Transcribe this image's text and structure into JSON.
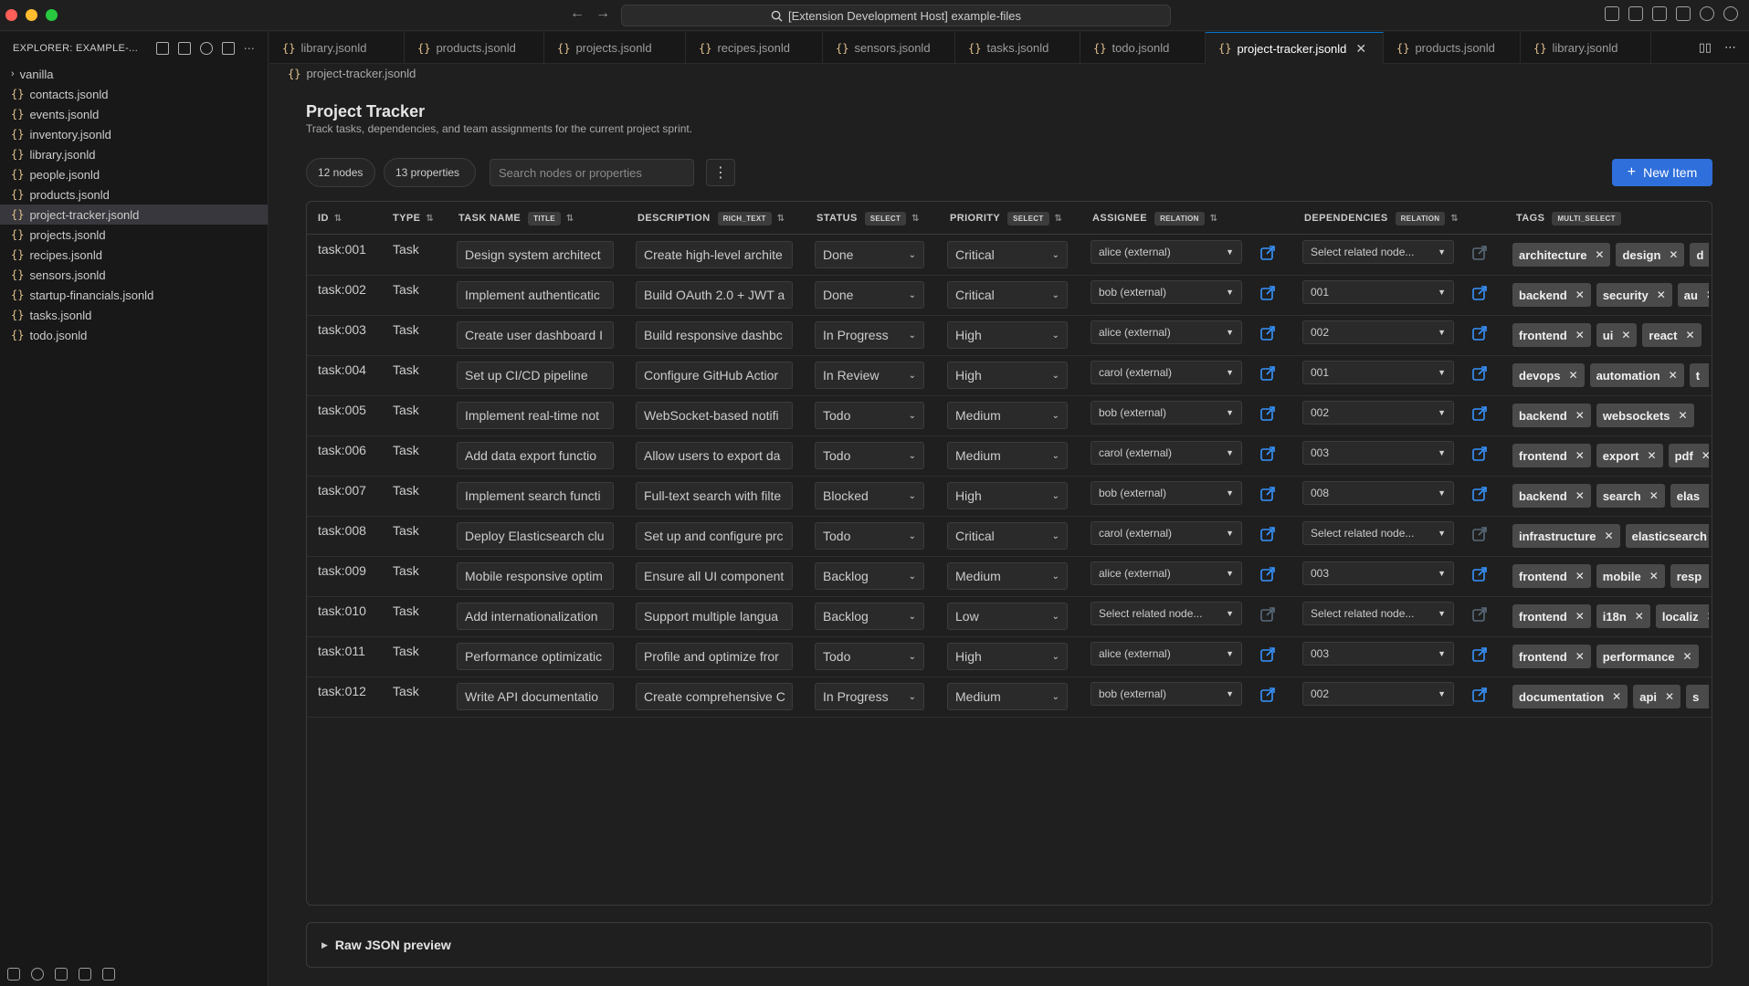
{
  "window": {
    "search": "[Extension Development Host] example-files",
    "nav_back": "←",
    "nav_forward": "→"
  },
  "sidebar": {
    "header": "EXPLORER: EXAMPLE-...",
    "folder": "vanilla",
    "files": [
      "contacts.jsonld",
      "events.jsonld",
      "inventory.jsonld",
      "library.jsonld",
      "people.jsonld",
      "products.jsonld",
      "project-tracker.jsonld",
      "projects.jsonld",
      "recipes.jsonld",
      "sensors.jsonld",
      "startup-financials.jsonld",
      "tasks.jsonld",
      "todo.jsonld"
    ],
    "selected": "project-tracker.jsonld"
  },
  "tabs": [
    "library.jsonld",
    "products.jsonld",
    "projects.jsonld",
    "recipes.jsonld",
    "sensors.jsonld",
    "tasks.jsonld",
    "todo.jsonld",
    "project-tracker.jsonld",
    "products.jsonld",
    "library.jsonld"
  ],
  "active_tab": "project-tracker.jsonld",
  "breadcrumb": "project-tracker.jsonld",
  "page": {
    "title": "Project Tracker",
    "subtitle": "Track tasks, dependencies, and team assignments for the current project sprint."
  },
  "toolbar": {
    "nodes": "12 nodes",
    "properties": "13 properties",
    "search_placeholder": "Search nodes or properties",
    "kebab": "⋮",
    "new_item": "New Item"
  },
  "columns": {
    "id": "ID",
    "type": "TYPE",
    "task_name": "TASK NAME",
    "task_name_badge": "TITLE",
    "description": "DESCRIPTION",
    "description_badge": "RICH_TEXT",
    "status": "STATUS",
    "status_badge": "SELECT",
    "priority": "PRIORITY",
    "priority_badge": "SELECT",
    "assignee": "ASSIGNEE",
    "assignee_badge": "RELATION",
    "dependencies": "DEPENDENCIES",
    "dependencies_badge": "RELATION",
    "tags": "TAGS",
    "tags_badge": "MULTI_SELECT"
  },
  "rows": [
    {
      "id": "task:001",
      "type": "Task",
      "name": "Design system architect",
      "desc": "Create high-level archite",
      "status": "Done",
      "priority": "Critical",
      "assignee": "alice (external)",
      "assignee_set": true,
      "deps": "Select related node...",
      "deps_set": false,
      "tags": [
        "architecture",
        "design",
        "d"
      ]
    },
    {
      "id": "task:002",
      "type": "Task",
      "name": "Implement authenticatic",
      "desc": "Build OAuth 2.0 + JWT a",
      "status": "Done",
      "priority": "Critical",
      "assignee": "bob (external)",
      "assignee_set": true,
      "deps": "001",
      "deps_set": true,
      "tags": [
        "backend",
        "security",
        "au"
      ]
    },
    {
      "id": "task:003",
      "type": "Task",
      "name": "Create user dashboard I",
      "desc": "Build responsive dashbc",
      "status": "In Progress",
      "priority": "High",
      "assignee": "alice (external)",
      "assignee_set": true,
      "deps": "002",
      "deps_set": true,
      "tags": [
        "frontend",
        "ui",
        "react"
      ]
    },
    {
      "id": "task:004",
      "type": "Task",
      "name": "Set up CI/CD pipeline",
      "desc": "Configure GitHub Actior",
      "status": "In Review",
      "priority": "High",
      "assignee": "carol (external)",
      "assignee_set": true,
      "deps": "001",
      "deps_set": true,
      "tags": [
        "devops",
        "automation",
        "t"
      ]
    },
    {
      "id": "task:005",
      "type": "Task",
      "name": "Implement real-time not",
      "desc": "WebSocket-based notifi",
      "status": "Todo",
      "priority": "Medium",
      "assignee": "bob (external)",
      "assignee_set": true,
      "deps": "002",
      "deps_set": true,
      "tags": [
        "backend",
        "websockets"
      ]
    },
    {
      "id": "task:006",
      "type": "Task",
      "name": "Add data export functio",
      "desc": "Allow users to export da",
      "status": "Todo",
      "priority": "Medium",
      "assignee": "carol (external)",
      "assignee_set": true,
      "deps": "003",
      "deps_set": true,
      "tags": [
        "frontend",
        "export",
        "pdf"
      ]
    },
    {
      "id": "task:007",
      "type": "Task",
      "name": "Implement search functi",
      "desc": "Full-text search with filte",
      "status": "Blocked",
      "priority": "High",
      "assignee": "bob (external)",
      "assignee_set": true,
      "deps": "008",
      "deps_set": true,
      "tags": [
        "backend",
        "search",
        "elas"
      ]
    },
    {
      "id": "task:008",
      "type": "Task",
      "name": "Deploy Elasticsearch clu",
      "desc": "Set up and configure prc",
      "status": "Todo",
      "priority": "Critical",
      "assignee": "carol (external)",
      "assignee_set": true,
      "deps": "Select related node...",
      "deps_set": false,
      "tags": [
        "infrastructure",
        "elasticsearch"
      ]
    },
    {
      "id": "task:009",
      "type": "Task",
      "name": "Mobile responsive optim",
      "desc": "Ensure all UI component",
      "status": "Backlog",
      "priority": "Medium",
      "assignee": "alice (external)",
      "assignee_set": true,
      "deps": "003",
      "deps_set": true,
      "tags": [
        "frontend",
        "mobile",
        "resp"
      ]
    },
    {
      "id": "task:010",
      "type": "Task",
      "name": "Add internationalization",
      "desc": "Support multiple langua",
      "status": "Backlog",
      "priority": "Low",
      "assignee": "Select related node...",
      "assignee_set": false,
      "deps": "Select related node...",
      "deps_set": false,
      "tags": [
        "frontend",
        "i18n",
        "localiz"
      ]
    },
    {
      "id": "task:011",
      "type": "Task",
      "name": "Performance optimizatic",
      "desc": "Profile and optimize fror",
      "status": "Todo",
      "priority": "High",
      "assignee": "alice (external)",
      "assignee_set": true,
      "deps": "003",
      "deps_set": true,
      "tags": [
        "frontend",
        "performance"
      ]
    },
    {
      "id": "task:012",
      "type": "Task",
      "name": "Write API documentatio",
      "desc": "Create comprehensive C",
      "status": "In Progress",
      "priority": "Medium",
      "assignee": "bob (external)",
      "assignee_set": true,
      "deps": "002",
      "deps_set": true,
      "tags": [
        "documentation",
        "api",
        "s"
      ]
    }
  ],
  "raw_json": "Raw JSON preview",
  "colors": {
    "accent": "#2f6fdb",
    "tag_bg": "#4a4a4a",
    "link_active": "#3794ff",
    "link_inactive": "#5a6a7a"
  }
}
